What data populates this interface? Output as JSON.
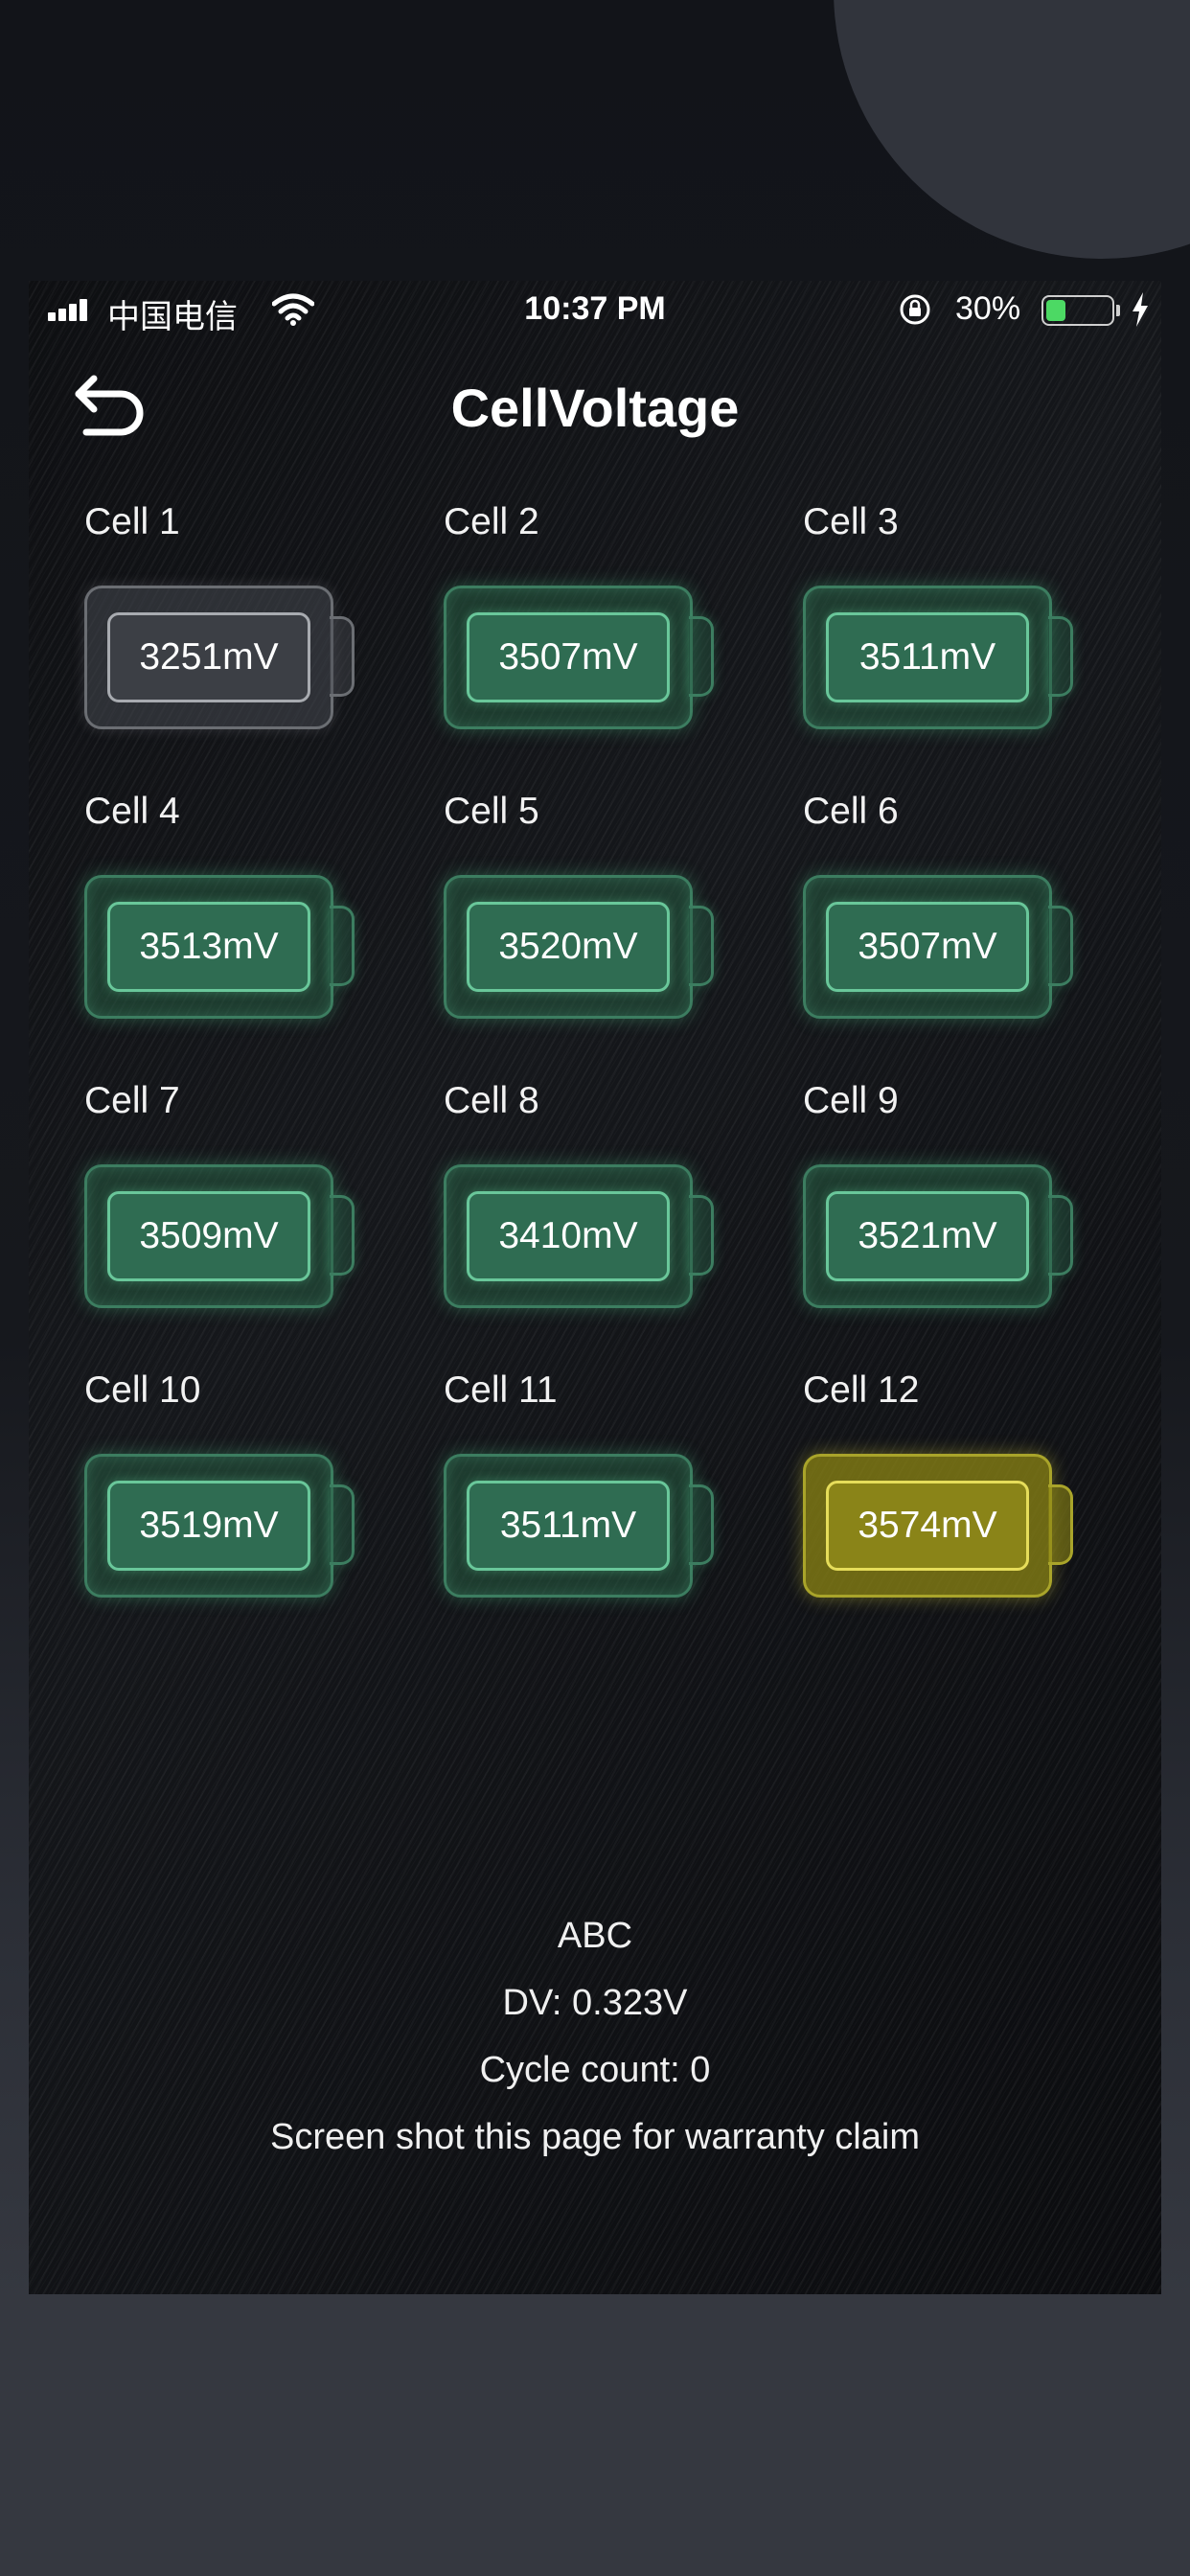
{
  "status_bar": {
    "carrier": "中国电信",
    "time": "10:37 PM",
    "battery_percent": "30%",
    "battery_level": 0.3,
    "icons": [
      "signal-icon",
      "wifi-icon",
      "rotation-lock-icon",
      "battery-icon",
      "charging-bolt-icon"
    ]
  },
  "header": {
    "title": "CellVoltage",
    "back_icon": "back-arrow-icon"
  },
  "cells": [
    {
      "label": "Cell 1",
      "voltage": "3251mV",
      "status": "gray"
    },
    {
      "label": "Cell 2",
      "voltage": "3507mV",
      "status": "green"
    },
    {
      "label": "Cell 3",
      "voltage": "3511mV",
      "status": "green"
    },
    {
      "label": "Cell 4",
      "voltage": "3513mV",
      "status": "green"
    },
    {
      "label": "Cell 5",
      "voltage": "3520mV",
      "status": "green"
    },
    {
      "label": "Cell 6",
      "voltage": "3507mV",
      "status": "green"
    },
    {
      "label": "Cell 7",
      "voltage": "3509mV",
      "status": "green"
    },
    {
      "label": "Cell 8",
      "voltage": "3410mV",
      "status": "green"
    },
    {
      "label": "Cell 9",
      "voltage": "3521mV",
      "status": "green"
    },
    {
      "label": "Cell 10",
      "voltage": "3519mV",
      "status": "green"
    },
    {
      "label": "Cell 11",
      "voltage": "3511mV",
      "status": "green"
    },
    {
      "label": "Cell 12",
      "voltage": "3574mV",
      "status": "yellow"
    }
  ],
  "footer": {
    "name": "ABC",
    "dv": "DV: 0.323V",
    "cycle_count": "Cycle count: 0",
    "note": "Screen shot this page for warranty claim"
  },
  "colors": {
    "green": "#3c7d60",
    "gray": "#6b6e73",
    "yellow": "#a9a42a",
    "charging": "#4cd964"
  }
}
